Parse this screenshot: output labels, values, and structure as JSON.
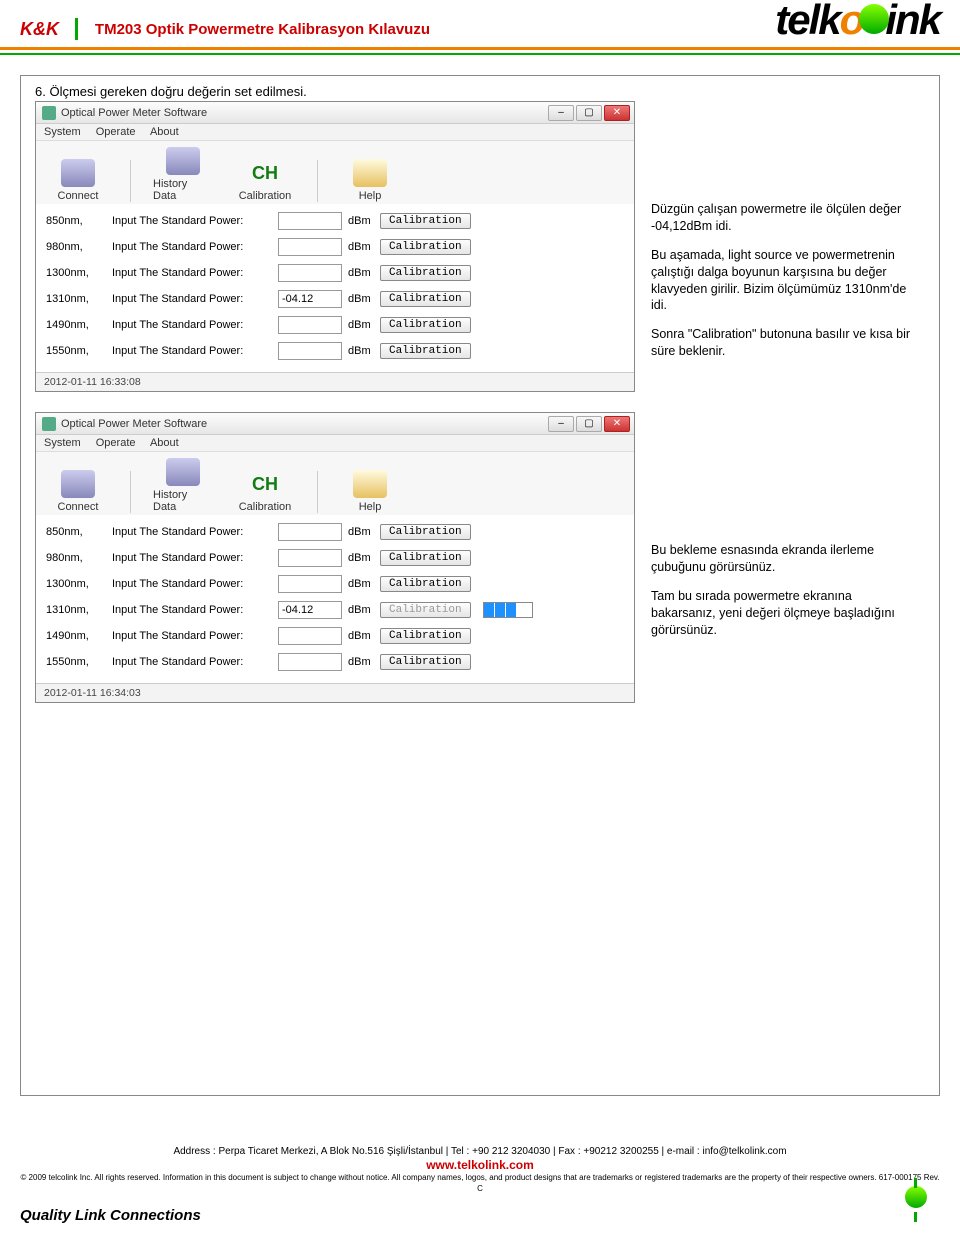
{
  "header": {
    "kk": "K&K",
    "title": "TM203 Optik Powermetre Kalibrasyon Kılavuzu",
    "logo_parts": {
      "a": "telk",
      "b": "o",
      "c": "ink"
    }
  },
  "section_heading": "6.  Ölçmesi gereken doğru değerin set edilmesi.",
  "app_window": {
    "title": "Optical Power Meter Software",
    "menus": [
      "System",
      "Operate",
      "About"
    ],
    "tools": {
      "connect": "Connect",
      "history": "History Data",
      "calibration": "Calibration",
      "cal_icon_text": "CH",
      "help": "Help"
    },
    "wavelengths": [
      "850nm,",
      "980nm,",
      "1300nm,",
      "1310nm,",
      "1490nm,",
      "1550nm,"
    ],
    "row_label": "Input The Standard Power:",
    "unit": "dBm",
    "cal_button": "Calibration",
    "input_value_1310": "-04.12",
    "status_time_1": "2012-01-11 16:33:08",
    "status_time_2": "2012-01-11 16:34:03"
  },
  "side_text_1": {
    "p1": "Düzgün çalışan powermetre ile ölçülen değer -04,12dBm idi.",
    "p2": "Bu aşamada, light source ve powermetrenin çalıştığı dalga boyunun karşısına bu değer klavyeden girilir. Bizim ölçümümüz 1310nm'de idi.",
    "p3": "Sonra \"Calibration\" butonuna basılır ve kısa bir süre beklenir."
  },
  "side_text_2": {
    "p1": "Bu bekleme esnasında ekranda ilerleme çubuğunu görürsünüz.",
    "p2": "Tam bu sırada powermetre ekranına bakarsanız, yeni değeri ölçmeye başladığını görürsünüz."
  },
  "footer": {
    "address": "Address : Perpa Ticaret Merkezi, A Blok No.516 Şişli/İstanbul  |  Tel : +90 212 3204030  |  Fax : +90212 3200255  |  e-mail : info@telkolink.com",
    "url": "www.telkolink.com",
    "legal": "© 2009 telcolink Inc. All rights reserved. Information in this document is subject to change without notice. All company names, logos, and product designs that are trademarks or registered trademarks are the property of their respective owners. 617-000175 Rev. C",
    "qlc": "Quality Link Connections"
  }
}
